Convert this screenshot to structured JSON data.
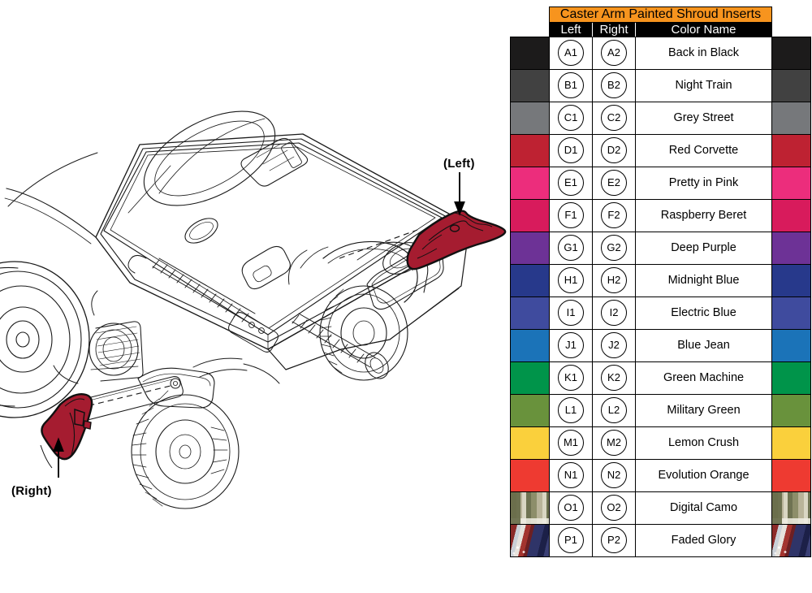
{
  "diagram": {
    "callouts": [
      {
        "id": "left-callout",
        "label": "(Left)"
      },
      {
        "id": "right-callout",
        "label": "(Right)"
      }
    ],
    "part_color": "#A51C30",
    "line_color": "#1a1a1a"
  },
  "table": {
    "title": "Caster Arm Painted Shroud Inserts",
    "title_bg": "#F7941E",
    "header_bg": "#000000",
    "columns": [
      "Left",
      "Right",
      "Color Name"
    ],
    "rows": [
      {
        "left": "A1",
        "right": "A2",
        "name": "Back in Black",
        "swatch": "#1C1B1B",
        "pattern": ""
      },
      {
        "left": "B1",
        "right": "B2",
        "name": "Night Train",
        "swatch": "#414141",
        "pattern": ""
      },
      {
        "left": "C1",
        "right": "C2",
        "name": "Grey Street",
        "swatch": "#76787B",
        "pattern": ""
      },
      {
        "left": "D1",
        "right": "D2",
        "name": "Red Corvette",
        "swatch": "#BE2232",
        "pattern": ""
      },
      {
        "left": "E1",
        "right": "E2",
        "name": "Pretty in Pink",
        "swatch": "#EC2D7C",
        "pattern": ""
      },
      {
        "left": "F1",
        "right": "F2",
        "name": "Raspberry Beret",
        "swatch": "#D81B5C",
        "pattern": ""
      },
      {
        "left": "G1",
        "right": "G2",
        "name": "Deep Purple",
        "swatch": "#6D3296",
        "pattern": ""
      },
      {
        "left": "H1",
        "right": "H2",
        "name": "Midnight Blue",
        "swatch": "#27398B",
        "pattern": ""
      },
      {
        "left": "I1",
        "right": "I2",
        "name": "Electric Blue",
        "swatch": "#3F4B9E",
        "pattern": ""
      },
      {
        "left": "J1",
        "right": "J2",
        "name": "Blue Jean",
        "swatch": "#1B73B8",
        "pattern": ""
      },
      {
        "left": "K1",
        "right": "K2",
        "name": "Green Machine",
        "swatch": "#00944A",
        "pattern": ""
      },
      {
        "left": "L1",
        "right": "L2",
        "name": "Military Green",
        "swatch": "#69923C",
        "pattern": ""
      },
      {
        "left": "M1",
        "right": "M2",
        "name": "Lemon Crush",
        "swatch": "#FAD03C",
        "pattern": ""
      },
      {
        "left": "N1",
        "right": "N2",
        "name": "Evolution Orange",
        "swatch": "#EE3A31",
        "pattern": ""
      },
      {
        "left": "O1",
        "right": "O2",
        "name": "Digital Camo",
        "swatch": "#B7B296",
        "pattern": "camo"
      },
      {
        "left": "P1",
        "right": "P2",
        "name": "Faded Glory",
        "swatch": "#2B2F63",
        "pattern": "flag"
      }
    ]
  }
}
